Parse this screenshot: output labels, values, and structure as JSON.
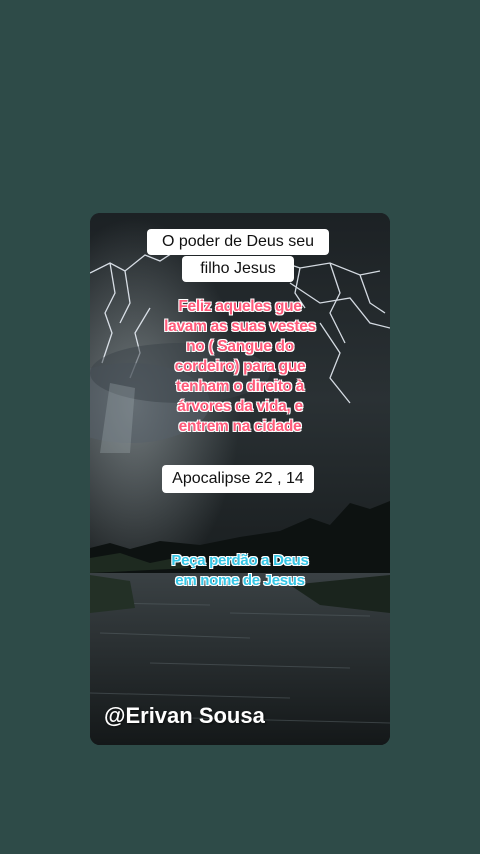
{
  "post": {
    "title_line1": "O poder de Deus seu",
    "title_line2": "filho Jesus",
    "verse_lines": [
      "Feliz aqueles  gue",
      "lavam as suas vestes",
      "no ( Sangue do",
      "cordeiro) para  gue",
      "tenham  o direito  à",
      "árvores da vida,  e",
      "entrem na cidade"
    ],
    "reference": "Apocalipse 22 , 14",
    "plea_lines": [
      "Peça  perdão a Deus",
      "em nome de Jesus"
    ],
    "author_handle": "@Erivan Sousa"
  },
  "colors": {
    "page_background": "#2e4b48",
    "verse_text": "#ff5a7a",
    "plea_text": "#35c6e6"
  }
}
